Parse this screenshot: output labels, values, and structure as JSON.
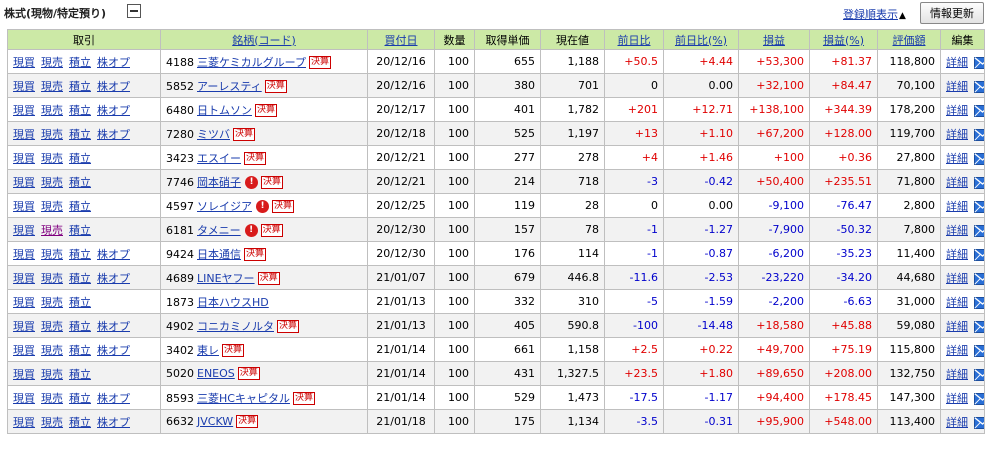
{
  "section": {
    "title": "株式(現物/特定預り)",
    "sort_link": "登録順表示",
    "sort_indicator": "▲",
    "refresh_label": "情報更新"
  },
  "headers": {
    "trade": "取引",
    "name": "銘柄(コード)",
    "date": "買付日",
    "qty": "数量",
    "cost": "取得単価",
    "price": "現在値",
    "change": "前日比",
    "change_pct": "前日比(%)",
    "pl": "損益",
    "pl_pct": "損益(%)",
    "value": "評価額",
    "edit": "編集"
  },
  "labels": {
    "buy": "現買",
    "sell": "現売",
    "accumulate": "積立",
    "option": "株オプ",
    "earnings_badge": "決算",
    "alert_mark": "!",
    "detail": "詳細"
  },
  "colors": {
    "header_bg": "#cce9a6",
    "positive": "#e00000",
    "negative": "#0000cc",
    "link": "#1a3cad",
    "mail_icon": "#2a6fd6"
  },
  "rows": [
    {
      "code": "4188",
      "name": "三菱ケミカルグループ",
      "badge": true,
      "alert": false,
      "option": true,
      "date": "20/12/16",
      "qty": "100",
      "cost": "655",
      "price": "1,188",
      "change": "+50.5",
      "change_pct": "+4.44",
      "pl": "+53,300",
      "pl_pct": "+81.37",
      "value": "118,800",
      "sign": "pos"
    },
    {
      "code": "5852",
      "name": "アーレスティ",
      "badge": true,
      "alert": false,
      "option": true,
      "date": "20/12/16",
      "qty": "100",
      "cost": "380",
      "price": "701",
      "change": "0",
      "change_pct": "0.00",
      "pl": "+32,100",
      "pl_pct": "+84.47",
      "value": "70,100",
      "sign": "zero"
    },
    {
      "code": "6480",
      "name": "日トムソン",
      "badge": true,
      "alert": false,
      "option": true,
      "date": "20/12/17",
      "qty": "100",
      "cost": "401",
      "price": "1,782",
      "change": "+201",
      "change_pct": "+12.71",
      "pl": "+138,100",
      "pl_pct": "+344.39",
      "value": "178,200",
      "sign": "pos"
    },
    {
      "code": "7280",
      "name": "ミツバ",
      "badge": true,
      "alert": false,
      "option": true,
      "date": "20/12/18",
      "qty": "100",
      "cost": "525",
      "price": "1,197",
      "change": "+13",
      "change_pct": "+1.10",
      "pl": "+67,200",
      "pl_pct": "+128.00",
      "value": "119,700",
      "sign": "pos"
    },
    {
      "code": "3423",
      "name": "エスイー",
      "badge": true,
      "alert": false,
      "option": false,
      "date": "20/12/21",
      "qty": "100",
      "cost": "277",
      "price": "278",
      "change": "+4",
      "change_pct": "+1.46",
      "pl": "+100",
      "pl_pct": "+0.36",
      "value": "27,800",
      "sign": "pos"
    },
    {
      "code": "7746",
      "name": "岡本硝子",
      "badge": true,
      "alert": true,
      "option": false,
      "date": "20/12/21",
      "qty": "100",
      "cost": "214",
      "price": "718",
      "change": "-3",
      "change_pct": "-0.42",
      "pl": "+50,400",
      "pl_pct": "+235.51",
      "value": "71,800",
      "sign": "mixed"
    },
    {
      "code": "4597",
      "name": "ソレイジア",
      "badge": true,
      "alert": true,
      "option": false,
      "date": "20/12/25",
      "qty": "100",
      "cost": "119",
      "price": "28",
      "change": "0",
      "change_pct": "0.00",
      "pl": "-9,100",
      "pl_pct": "-76.47",
      "value": "2,800",
      "sign": "zero-neg"
    },
    {
      "code": "6181",
      "name": "タメニー",
      "badge": true,
      "alert": true,
      "option": false,
      "sell_visited": true,
      "date": "20/12/30",
      "qty": "100",
      "cost": "157",
      "price": "78",
      "change": "-1",
      "change_pct": "-1.27",
      "pl": "-7,900",
      "pl_pct": "-50.32",
      "value": "7,800",
      "sign": "neg"
    },
    {
      "code": "9424",
      "name": "日本通信",
      "badge": true,
      "alert": false,
      "option": true,
      "date": "20/12/30",
      "qty": "100",
      "cost": "176",
      "price": "114",
      "change": "-1",
      "change_pct": "-0.87",
      "pl": "-6,200",
      "pl_pct": "-35.23",
      "value": "11,400",
      "sign": "neg"
    },
    {
      "code": "4689",
      "name": "LINEヤフー",
      "badge": true,
      "alert": false,
      "option": true,
      "date": "21/01/07",
      "qty": "100",
      "cost": "679",
      "price": "446.8",
      "change": "-11.6",
      "change_pct": "-2.53",
      "pl": "-23,220",
      "pl_pct": "-34.20",
      "value": "44,680",
      "sign": "neg"
    },
    {
      "code": "1873",
      "name": "日本ハウスHD",
      "badge": false,
      "alert": false,
      "option": false,
      "date": "21/01/13",
      "qty": "100",
      "cost": "332",
      "price": "310",
      "change": "-5",
      "change_pct": "-1.59",
      "pl": "-2,200",
      "pl_pct": "-6.63",
      "value": "31,000",
      "sign": "neg"
    },
    {
      "code": "4902",
      "name": "コニカミノルタ",
      "badge": true,
      "alert": false,
      "option": true,
      "date": "21/01/13",
      "qty": "100",
      "cost": "405",
      "price": "590.8",
      "change": "-100",
      "change_pct": "-14.48",
      "pl": "+18,580",
      "pl_pct": "+45.88",
      "value": "59,080",
      "sign": "mixed"
    },
    {
      "code": "3402",
      "name": "東レ",
      "badge": true,
      "alert": false,
      "option": true,
      "date": "21/01/14",
      "qty": "100",
      "cost": "661",
      "price": "1,158",
      "change": "+2.5",
      "change_pct": "+0.22",
      "pl": "+49,700",
      "pl_pct": "+75.19",
      "value": "115,800",
      "sign": "pos"
    },
    {
      "code": "5020",
      "name": "ENEOS",
      "badge": true,
      "alert": false,
      "option": false,
      "date": "21/01/14",
      "qty": "100",
      "cost": "431",
      "price": "1,327.5",
      "change": "+23.5",
      "change_pct": "+1.80",
      "pl": "+89,650",
      "pl_pct": "+208.00",
      "value": "132,750",
      "sign": "pos"
    },
    {
      "code": "8593",
      "name": "三菱HCキャピタル",
      "badge": true,
      "alert": false,
      "option": true,
      "date": "21/01/14",
      "qty": "100",
      "cost": "529",
      "price": "1,473",
      "change": "-17.5",
      "change_pct": "-1.17",
      "pl": "+94,400",
      "pl_pct": "+178.45",
      "value": "147,300",
      "sign": "mixed"
    },
    {
      "code": "6632",
      "name": "JVCKW",
      "badge": true,
      "alert": false,
      "option": true,
      "date": "21/01/18",
      "qty": "100",
      "cost": "175",
      "price": "1,134",
      "change": "-3.5",
      "change_pct": "-0.31",
      "pl": "+95,900",
      "pl_pct": "+548.00",
      "value": "113,400",
      "sign": "mixed"
    }
  ]
}
